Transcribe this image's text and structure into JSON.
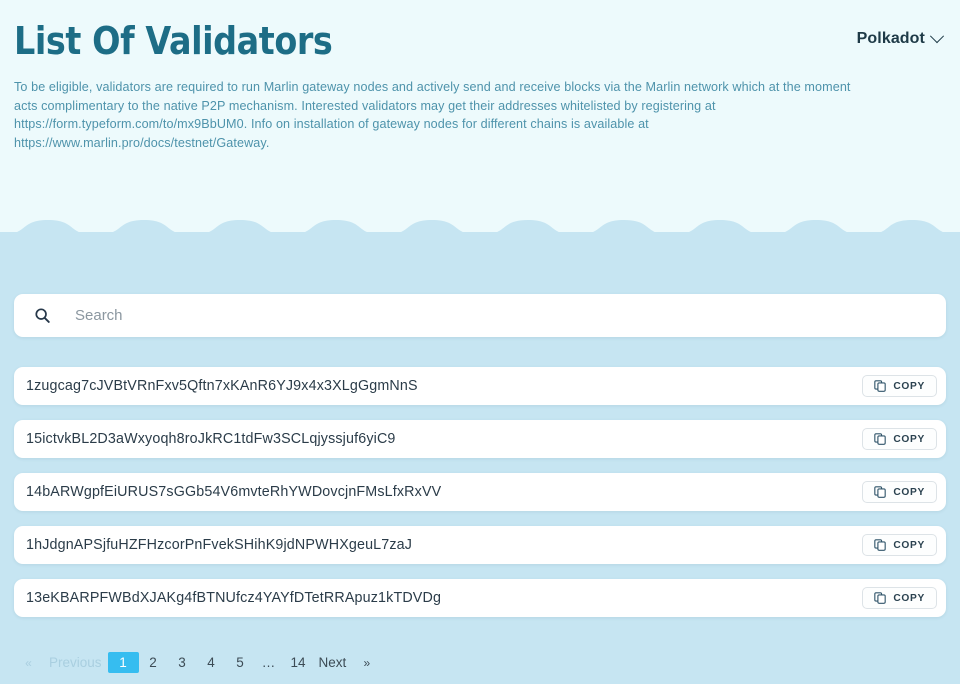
{
  "header": {
    "title": "List Of Validators",
    "network": {
      "label": "Polkadot",
      "chevron_icon": "chevron-down-icon"
    },
    "description_lines": [
      "To be eligible, validators are required to run Marlin gateway nodes and actively send and receive blocks via the Marlin network which at the moment",
      "acts complimentary to the native P2P mechanism. Interested validators may get their addresses whitelisted by registering at",
      "https://form.typeform.com/to/mx9BbUM0. Info on installation of gateway nodes for different chains is available at",
      "https://www.marlin.pro/docs/testnet/Gateway."
    ]
  },
  "search": {
    "icon": "search-icon",
    "placeholder": "Search",
    "value": ""
  },
  "validators": [
    {
      "address": "1zugcag7cJVBtVRnFxv5Qftn7xKAnR6YJ9x4x3XLgGgmNnS",
      "copy_label": "COPY",
      "copy_icon": "copy-icon"
    },
    {
      "address": "15ictvkBL2D3aWxyoqh8roJkRC1tdFw3SCLqjyssjuf6yiC9",
      "copy_label": "COPY",
      "copy_icon": "copy-icon"
    },
    {
      "address": "14bARWgpfEiURUS7sGGb54V6mvteRhYWDovcjnFMsLfxRxVV",
      "copy_label": "COPY",
      "copy_icon": "copy-icon"
    },
    {
      "address": "1hJdgnAPSjfuHZFHzcorPnFvekSHihK9jdNPWHXgeuL7zaJ",
      "copy_label": "COPY",
      "copy_icon": "copy-icon"
    },
    {
      "address": "13eKBARPFWBdXJAKg4fBTNUfcz4YAYfDTetRRApuz1kTDVDg",
      "copy_label": "COPY",
      "copy_icon": "copy-icon"
    }
  ],
  "pagination": {
    "first_arrow": "«",
    "previous_label": "Previous",
    "pages": [
      "1",
      "2",
      "3",
      "4",
      "5"
    ],
    "ellipsis": "…",
    "last_page": "14",
    "next_label": "Next",
    "last_arrow": "»",
    "active_page": "1"
  },
  "colors": {
    "hero_background": "#edfafc",
    "pane_background": "#c6e5f2",
    "wave_fill": "#c6e5f2",
    "title": "#1d6d86",
    "description": "#4e93ab",
    "accent_active": "#36bdf0",
    "card": "#ffffff",
    "address_text": "#2b3c49",
    "network_text": "#1e3a47"
  }
}
